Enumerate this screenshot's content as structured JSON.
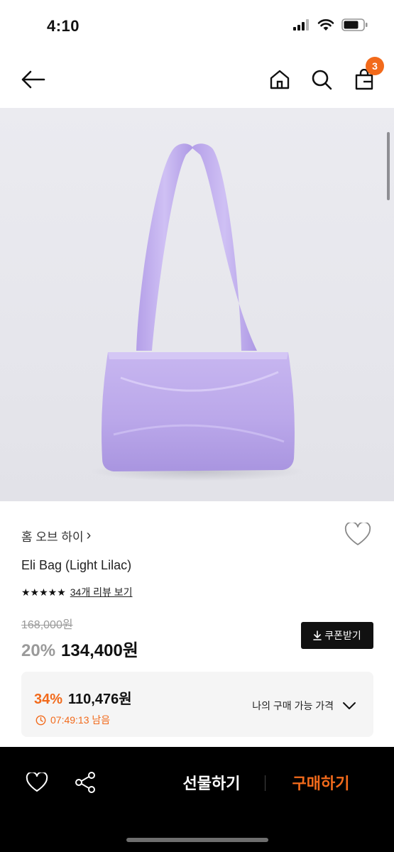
{
  "status_bar": {
    "time": "4:10"
  },
  "header": {
    "cart_count": "3"
  },
  "product": {
    "brand": "홈 오브 하이",
    "brand_chevron": "›",
    "name": "Eli Bag (Light Lilac)",
    "stars": "★★★★★",
    "rating_stars": 5,
    "review_link": "34개 리뷰 보기",
    "original_price": "168,000원",
    "discount_rate": "20%",
    "sale_price": "134,400원",
    "coupon_label": "쿠폰받기"
  },
  "best_price": {
    "discount_rate": "34%",
    "price": "110,476원",
    "timer": "07:49:13 남음",
    "my_price_label": "나의 구매 가능 가격"
  },
  "bottom_bar": {
    "gift_label": "선물하기",
    "buy_label": "구매하기"
  },
  "colors": {
    "accent": "#f26a1b",
    "bag": "#c4b2ec",
    "bottom_bar_bg": "#000000"
  }
}
